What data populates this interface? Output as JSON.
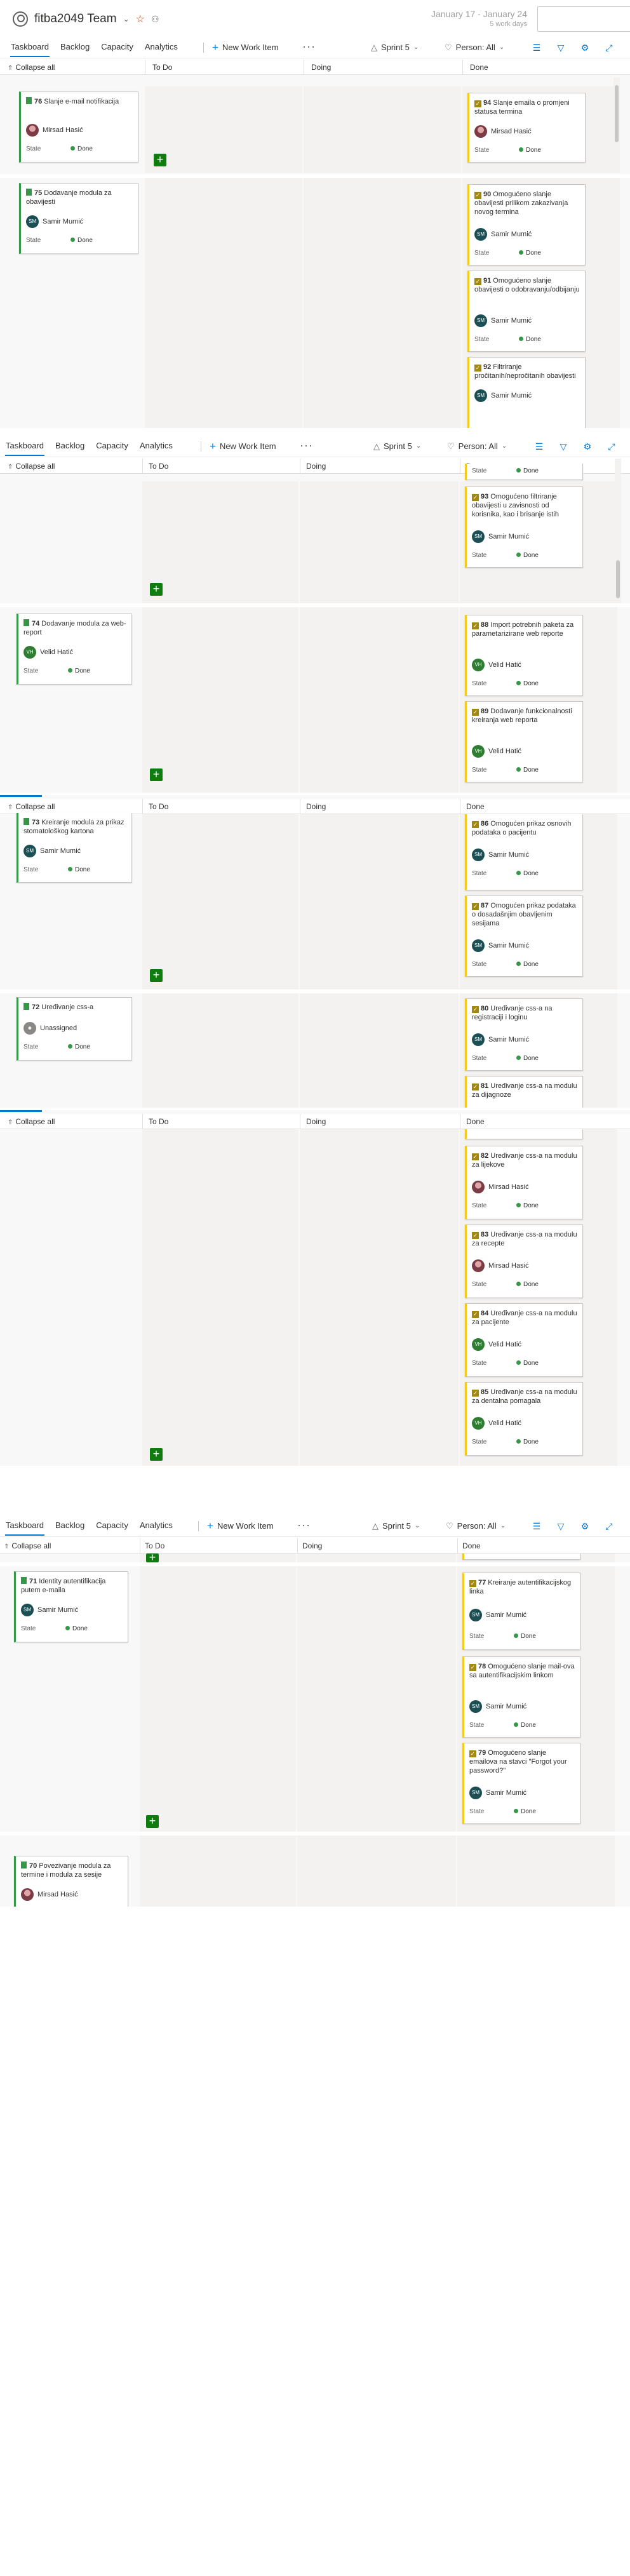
{
  "header": {
    "team_name": "fitba2049 Team",
    "date_range": "January 17 - January 24",
    "work_days": "5 work days"
  },
  "toolbar": {
    "tabs": [
      "Taskboard",
      "Backlog",
      "Capacity",
      "Analytics"
    ],
    "new_work_item": "New Work Item",
    "sprint": "Sprint 5",
    "person": "Person: All"
  },
  "board": {
    "collapse_all": "Collapse all",
    "columns": [
      "To Do",
      "Doing",
      "Done"
    ],
    "state_label": "State",
    "state_done": "Done"
  },
  "cards": {
    "c76": {
      "id": "76",
      "title": "Slanje e-mail notifikacija",
      "assignee": "Mirsad Hasić"
    },
    "c75": {
      "id": "75",
      "title": "Dodavanje modula za obavijesti",
      "assignee": "Samir Mumić"
    },
    "c94": {
      "id": "94",
      "title": "Slanje emaila o promjeni statusa termina",
      "assignee": "Mirsad Hasić"
    },
    "c90": {
      "id": "90",
      "title": "Omogućeno slanje obavijesti prilikom zakazivanja novog termina",
      "assignee": "Samir Mumić"
    },
    "c91": {
      "id": "91",
      "title": "Omogućeno slanje obavijesti o odobravanju/odbijanju",
      "assignee": "Samir Mumić"
    },
    "c92": {
      "id": "92",
      "title": "Filtriranje pročitanih/nepročitanih obavijesti",
      "assignee": "Samir Mumić"
    },
    "c93": {
      "id": "93",
      "title": "Omogućeno filtriranje obavijesti u zavisnosti od korisnika, kao i brisanje istih",
      "assignee": "Samir Mumić"
    },
    "c74": {
      "id": "74",
      "title": "Dodavanje modula za web-report",
      "assignee": "Velid Hatić"
    },
    "c88": {
      "id": "88",
      "title": "Import potrebnih paketa za parametarizirane web reporte",
      "assignee": "Velid Hatić"
    },
    "c89": {
      "id": "89",
      "title": "Dodavanje funkcionalnosti kreiranja web reporta",
      "assignee": "Velid Hatić"
    },
    "c73": {
      "id": "73",
      "title": "Kreiranje modula za prikaz stomatološkog kartona",
      "assignee": "Samir Mumić"
    },
    "c86": {
      "id": "86",
      "title": "Omogućen prikaz osnovih podataka o pacijentu",
      "assignee": "Samir Mumić"
    },
    "c87": {
      "id": "87",
      "title": "Omogućen prikaz podataka o dosadašnjim obavljenim sesijama",
      "assignee": "Samir Mumić"
    },
    "c72": {
      "id": "72",
      "title": "Uređivanje css-a",
      "assignee": "Unassigned"
    },
    "c80": {
      "id": "80",
      "title": "Uređivanje css-a na registraciji i loginu",
      "assignee": "Samir Mumić"
    },
    "c81": {
      "id": "81",
      "title": "Uređivanje css-a na modulu za dijagnoze",
      "assignee": ""
    },
    "c82": {
      "id": "82",
      "title": "Uređivanje css-a na modulu za lijekove",
      "assignee": "Mirsad Hasić"
    },
    "c83": {
      "id": "83",
      "title": "Uređivanje css-a na modulu za recepte",
      "assignee": "Mirsad Hasić"
    },
    "c84": {
      "id": "84",
      "title": "Uređivanje css-a na modulu za pacijente",
      "assignee": "Velid Hatić"
    },
    "c85": {
      "id": "85",
      "title": "Uređivanje css-a na modulu za dentalna pomagala",
      "assignee": "Velid Hatić"
    },
    "c71": {
      "id": "71",
      "title": "Identity autentifikacija putem e-maila",
      "assignee": "Samir Mumić"
    },
    "c77": {
      "id": "77",
      "title": "Kreiranje autentifikacijskog linka",
      "assignee": "Samir Mumić"
    },
    "c78": {
      "id": "78",
      "title": "Omogućeno slanje mail-ova sa autentifikacijskim linkom",
      "assignee": "Samir Mumić"
    },
    "c79": {
      "id": "79",
      "title": "Omogućeno slanje emailova na stavci \"Forgot your password?\"",
      "assignee": "Samir Mumić"
    },
    "c70": {
      "id": "70",
      "title": "Povezivanje modula za termine i modula za sesije",
      "assignee": "Mirsad Hasić"
    }
  },
  "initials": {
    "samir": "SM",
    "velid": "VH"
  },
  "icons": [
    "team-icon",
    "favorite-star-icon",
    "team-members-icon",
    "sprint-icon",
    "person-filter-icon",
    "settings-sliders-icon",
    "filter-icon",
    "gear-icon",
    "fullscreen-icon"
  ],
  "colors": {
    "accent": "#0078d4",
    "done_dot": "#339947",
    "task_border": "#f2cb1d",
    "add_button": "#107c10"
  }
}
